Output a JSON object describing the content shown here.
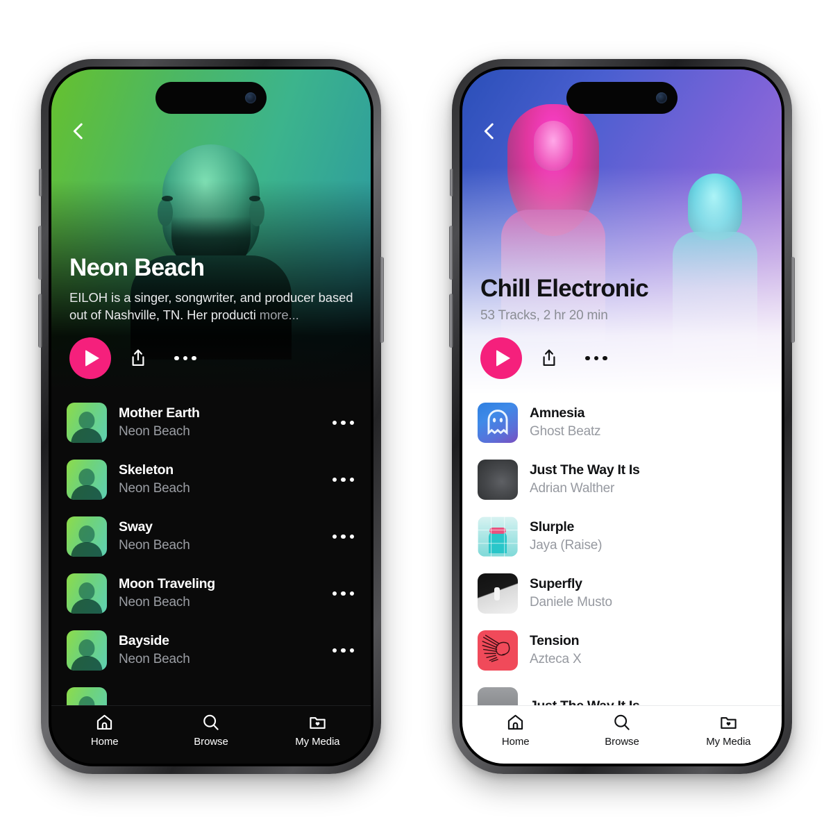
{
  "theme_colors": {
    "accent_pink": "#f5207c",
    "dark_bg": "#0a0a0a",
    "light_bg": "#ffffff",
    "muted_dark": "#9b9ea4",
    "muted_light": "#9699a0"
  },
  "phones": [
    {
      "id": "artist-page",
      "theme": "dark",
      "back_icon": "chevron-left-icon",
      "hero": {
        "title": "Neon Beach",
        "description": "EILOH is a singer, songwriter, and producer based out of Nashville, TN. Her producti",
        "more_label": "more...",
        "meta": ""
      },
      "actions": {
        "play_icon": "play-icon",
        "share_icon": "share-icon",
        "more_icon": "more-horizontal-icon"
      },
      "tracks": [
        {
          "title": "Mother Earth",
          "artist": "Neon Beach",
          "art": "portrait",
          "more_icon": "more-horizontal-icon"
        },
        {
          "title": "Skeleton",
          "artist": "Neon Beach",
          "art": "portrait",
          "more_icon": "more-horizontal-icon"
        },
        {
          "title": "Sway",
          "artist": "Neon Beach",
          "art": "portrait",
          "more_icon": "more-horizontal-icon"
        },
        {
          "title": "Moon Traveling",
          "artist": "Neon Beach",
          "art": "portrait",
          "more_icon": "more-horizontal-icon"
        },
        {
          "title": "Bayside",
          "artist": "Neon Beach",
          "art": "portrait",
          "more_icon": "more-horizontal-icon"
        },
        {
          "title": "",
          "artist": "",
          "art": "portrait",
          "more_icon": "more-horizontal-icon"
        }
      ],
      "nav": [
        {
          "label": "Home",
          "icon": "home-icon"
        },
        {
          "label": "Browse",
          "icon": "search-icon"
        },
        {
          "label": "My Media",
          "icon": "folder-heart-icon"
        }
      ]
    },
    {
      "id": "playlist-page",
      "theme": "light",
      "back_icon": "chevron-left-icon",
      "hero": {
        "title": "Chill Electronic",
        "description": "",
        "more_label": "",
        "meta": "53 Tracks, 2 hr 20 min"
      },
      "actions": {
        "play_icon": "play-icon",
        "share_icon": "share-icon",
        "more_icon": "more-horizontal-icon"
      },
      "tracks": [
        {
          "title": "Amnesia",
          "artist": "Ghost Beatz",
          "art": "ghost"
        },
        {
          "title": "Just The Way It Is",
          "artist": "Adrian Walther",
          "art": "dark"
        },
        {
          "title": "Slurple",
          "artist": "Jaya (Raise)",
          "art": "tile"
        },
        {
          "title": "Superfly",
          "artist": "Daniele Musto",
          "art": "bw"
        },
        {
          "title": "Tension",
          "artist": "Azteca X",
          "art": "red"
        },
        {
          "title": "Just The Way It Is",
          "artist": "",
          "art": "grey"
        }
      ],
      "nav": [
        {
          "label": "Home",
          "icon": "home-icon"
        },
        {
          "label": "Browse",
          "icon": "search-icon"
        },
        {
          "label": "My Media",
          "icon": "folder-heart-icon"
        }
      ]
    }
  ]
}
